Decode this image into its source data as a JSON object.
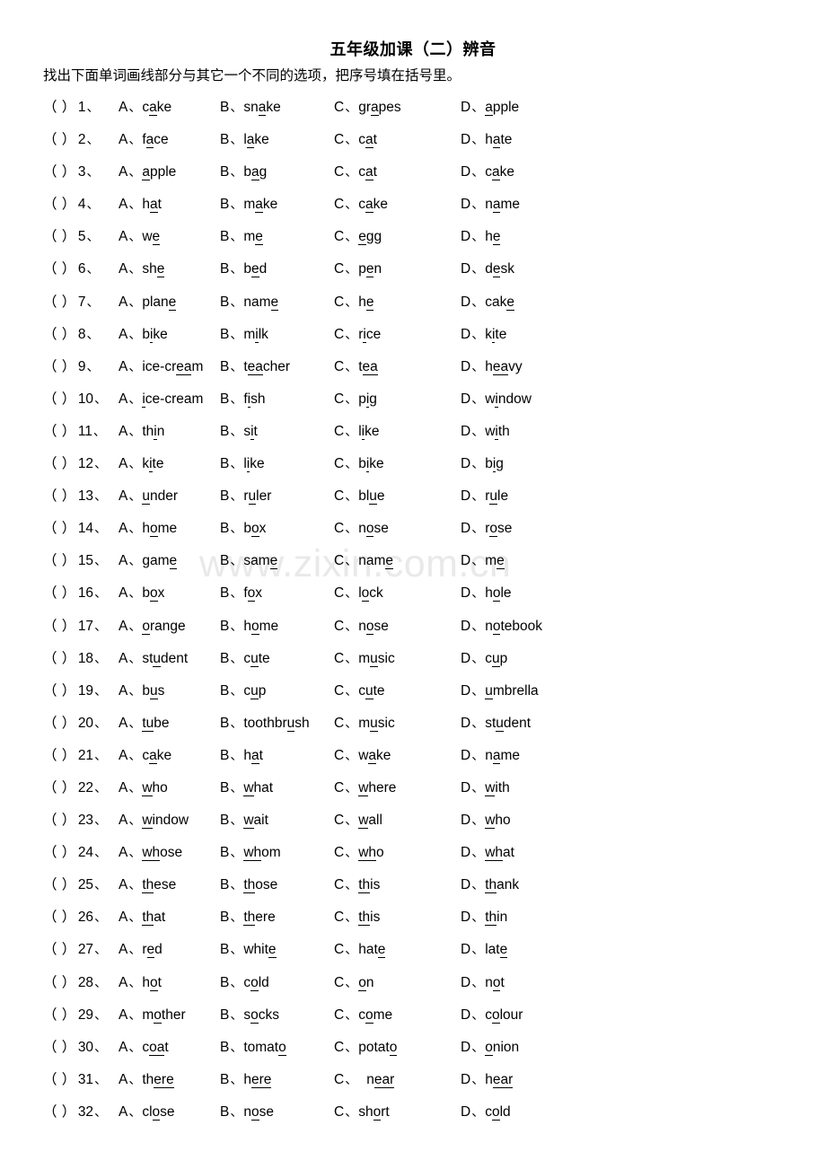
{
  "document": {
    "title": "五年级加课（二）辨音",
    "instruction": "找出下面单词画线部分与其它一个不同的选项，把序号填在括号里。",
    "watermark": "www.zixin.com.cn",
    "paren_blank": "（ ）",
    "cn_comma": "、",
    "option_letters": [
      "A",
      "B",
      "C",
      "D"
    ]
  },
  "questions": [
    {
      "number": "1",
      "options": [
        {
          "letter": "A",
          "pre": "c",
          "mark": "a",
          "post": "ke"
        },
        {
          "letter": "B",
          "pre": "sn",
          "mark": "a",
          "post": "ke"
        },
        {
          "letter": "C",
          "pre": "gr",
          "mark": "a",
          "post": "pes"
        },
        {
          "letter": "D",
          "pre": "",
          "mark": "a",
          "post": "pple"
        }
      ]
    },
    {
      "number": "2",
      "options": [
        {
          "letter": "A",
          "pre": "f",
          "mark": "a",
          "post": "ce"
        },
        {
          "letter": "B",
          "pre": "l",
          "mark": "a",
          "post": "ke"
        },
        {
          "letter": "C",
          "pre": "c",
          "mark": "a",
          "post": "t"
        },
        {
          "letter": "D",
          "pre": "h",
          "mark": "a",
          "post": "te"
        }
      ]
    },
    {
      "number": "3",
      "options": [
        {
          "letter": "A",
          "pre": "",
          "mark": "a",
          "post": "pple"
        },
        {
          "letter": "B",
          "pre": "b",
          "mark": "a",
          "post": "g"
        },
        {
          "letter": "C",
          "pre": "c",
          "mark": "a",
          "post": "t"
        },
        {
          "letter": "D",
          "pre": "c",
          "mark": "a",
          "post": "ke"
        }
      ]
    },
    {
      "number": "4",
      "options": [
        {
          "letter": "A",
          "pre": "h",
          "mark": "a",
          "post": "t"
        },
        {
          "letter": "B",
          "pre": "m",
          "mark": "a",
          "post": "ke"
        },
        {
          "letter": "C",
          "pre": "c",
          "mark": "a",
          "post": "ke"
        },
        {
          "letter": "D",
          "pre": "n",
          "mark": "a",
          "post": "me"
        }
      ]
    },
    {
      "number": "5",
      "options": [
        {
          "letter": "A",
          "pre": "w",
          "mark": "e",
          "post": ""
        },
        {
          "letter": "B",
          "pre": "m",
          "mark": "e",
          "post": ""
        },
        {
          "letter": "C",
          "pre": "",
          "mark": "e",
          "post": "gg"
        },
        {
          "letter": "D",
          "pre": "h",
          "mark": "e",
          "post": ""
        }
      ]
    },
    {
      "number": "6",
      "options": [
        {
          "letter": "A",
          "pre": "sh",
          "mark": "e",
          "post": ""
        },
        {
          "letter": "B",
          "pre": "b",
          "mark": "e",
          "post": "d"
        },
        {
          "letter": "C",
          "pre": "p",
          "mark": "e",
          "post": "n"
        },
        {
          "letter": "D",
          "pre": "d",
          "mark": "e",
          "post": "sk"
        }
      ]
    },
    {
      "number": "7",
      "options": [
        {
          "letter": "A",
          "pre": "plan",
          "mark": "e",
          "post": ""
        },
        {
          "letter": "B",
          "pre": "nam",
          "mark": "e",
          "post": ""
        },
        {
          "letter": "C",
          "pre": "h",
          "mark": "e",
          "post": ""
        },
        {
          "letter": "D",
          "pre": "cak",
          "mark": "e",
          "post": ""
        }
      ]
    },
    {
      "number": "8",
      "options": [
        {
          "letter": "A",
          "pre": "b",
          "mark": "i",
          "post": "ke"
        },
        {
          "letter": "B",
          "pre": "m",
          "mark": "i",
          "post": "lk"
        },
        {
          "letter": "C",
          "pre": "r",
          "mark": "i",
          "post": "ce"
        },
        {
          "letter": "D",
          "pre": "k",
          "mark": "i",
          "post": "te"
        }
      ]
    },
    {
      "number": "9",
      "options": [
        {
          "letter": "A",
          "pre": "ice-cr",
          "mark": "ea",
          "post": "m"
        },
        {
          "letter": "B",
          "pre": "t",
          "mark": "ea",
          "post": "cher"
        },
        {
          "letter": "C",
          "pre": "t",
          "mark": "ea",
          "post": ""
        },
        {
          "letter": "D",
          "pre": "h",
          "mark": "ea",
          "post": "vy"
        }
      ]
    },
    {
      "number": "10",
      "options": [
        {
          "letter": "A",
          "pre": "",
          "mark": "i",
          "post": "ce-cream"
        },
        {
          "letter": "B",
          "pre": "f",
          "mark": "i",
          "post": "sh"
        },
        {
          "letter": "C",
          "pre": "p",
          "mark": "i",
          "post": "g"
        },
        {
          "letter": "D",
          "pre": "w",
          "mark": "i",
          "post": "ndow"
        }
      ]
    },
    {
      "number": "11",
      "options": [
        {
          "letter": "A",
          "pre": "th",
          "mark": "i",
          "post": "n"
        },
        {
          "letter": "B",
          "pre": "s",
          "mark": "i",
          "post": "t"
        },
        {
          "letter": "C",
          "pre": "l",
          "mark": "i",
          "post": "ke"
        },
        {
          "letter": "D",
          "pre": "w",
          "mark": "i",
          "post": "th"
        }
      ]
    },
    {
      "number": "12",
      "options": [
        {
          "letter": "A",
          "pre": "k",
          "mark": "i",
          "post": "te"
        },
        {
          "letter": "B",
          "pre": "l",
          "mark": "i",
          "post": "ke"
        },
        {
          "letter": "C",
          "pre": "b",
          "mark": "i",
          "post": "ke"
        },
        {
          "letter": "D",
          "pre": "b",
          "mark": "i",
          "post": "g"
        }
      ]
    },
    {
      "number": "13",
      "options": [
        {
          "letter": "A",
          "pre": "",
          "mark": "u",
          "post": "nder"
        },
        {
          "letter": "B",
          "pre": "r",
          "mark": "u",
          "post": "ler"
        },
        {
          "letter": "C",
          "pre": "bl",
          "mark": "u",
          "post": "e"
        },
        {
          "letter": "D",
          "pre": "r",
          "mark": "u",
          "post": "le"
        }
      ]
    },
    {
      "number": "14",
      "options": [
        {
          "letter": "A",
          "pre": "h",
          "mark": "o",
          "post": "me"
        },
        {
          "letter": "B",
          "pre": "b",
          "mark": "o",
          "post": "x"
        },
        {
          "letter": "C",
          "pre": "n",
          "mark": "o",
          "post": "se"
        },
        {
          "letter": "D",
          "pre": "r",
          "mark": "o",
          "post": "se"
        }
      ]
    },
    {
      "number": "15",
      "options": [
        {
          "letter": "A",
          "pre": "gam",
          "mark": "e",
          "post": ""
        },
        {
          "letter": "B",
          "pre": "sam",
          "mark": "e",
          "post": ""
        },
        {
          "letter": "C",
          "pre": "nam",
          "mark": "e",
          "post": ""
        },
        {
          "letter": "D",
          "pre": "m",
          "mark": "e",
          "post": ""
        }
      ]
    },
    {
      "number": "16",
      "options": [
        {
          "letter": "A",
          "pre": "b",
          "mark": "o",
          "post": "x"
        },
        {
          "letter": "B",
          "pre": "f",
          "mark": "o",
          "post": "x"
        },
        {
          "letter": "C",
          "pre": "l",
          "mark": "o",
          "post": "ck"
        },
        {
          "letter": "D",
          "pre": "h",
          "mark": "o",
          "post": "le"
        }
      ]
    },
    {
      "number": "17",
      "options": [
        {
          "letter": "A",
          "pre": "",
          "mark": "o",
          "post": "range"
        },
        {
          "letter": "B",
          "pre": "h",
          "mark": "o",
          "post": "me"
        },
        {
          "letter": "C",
          "pre": "n",
          "mark": "o",
          "post": "se"
        },
        {
          "letter": "D",
          "pre": "n",
          "mark": "o",
          "post": "tebook"
        }
      ]
    },
    {
      "number": "18",
      "options": [
        {
          "letter": "A",
          "pre": "st",
          "mark": "u",
          "post": "dent"
        },
        {
          "letter": "B",
          "pre": "c",
          "mark": "u",
          "post": "te"
        },
        {
          "letter": "C",
          "pre": "m",
          "mark": "u",
          "post": "sic"
        },
        {
          "letter": "D",
          "pre": "c",
          "mark": "u",
          "post": "p"
        }
      ]
    },
    {
      "number": "19",
      "options": [
        {
          "letter": "A",
          "pre": "b",
          "mark": "u",
          "post": "s"
        },
        {
          "letter": "B",
          "pre": "c",
          "mark": "u",
          "post": "p"
        },
        {
          "letter": "C",
          "pre": "c",
          "mark": "u",
          "post": "te"
        },
        {
          "letter": "D",
          "pre": "",
          "mark": "u",
          "post": "mbrella"
        }
      ]
    },
    {
      "number": "20",
      "options": [
        {
          "letter": "A",
          "pre": "",
          "mark": "tu",
          "post": "be"
        },
        {
          "letter": "B",
          "pre": "toothbr",
          "mark": "u",
          "post": "sh"
        },
        {
          "letter": "C",
          "pre": "m",
          "mark": "u",
          "post": "sic"
        },
        {
          "letter": "D",
          "pre": "st",
          "mark": "u",
          "post": "dent"
        }
      ]
    },
    {
      "number": "21",
      "options": [
        {
          "letter": "A",
          "pre": "c",
          "mark": "a",
          "post": "ke"
        },
        {
          "letter": "B",
          "pre": "h",
          "mark": "a",
          "post": "t"
        },
        {
          "letter": "C",
          "pre": "w",
          "mark": "a",
          "post": "ke"
        },
        {
          "letter": "D",
          "pre": "n",
          "mark": "a",
          "post": "me"
        }
      ]
    },
    {
      "number": "22",
      "options": [
        {
          "letter": "A",
          "pre": "",
          "mark": "w",
          "post": "ho"
        },
        {
          "letter": "B",
          "pre": "",
          "mark": "w",
          "post": "hat"
        },
        {
          "letter": "C",
          "pre": "",
          "mark": "w",
          "post": "here"
        },
        {
          "letter": "D",
          "pre": "",
          "mark": "w",
          "post": "ith"
        }
      ]
    },
    {
      "number": "23",
      "options": [
        {
          "letter": "A",
          "pre": "",
          "mark": "w",
          "post": "indow"
        },
        {
          "letter": "B",
          "pre": "",
          "mark": "w",
          "post": "ait"
        },
        {
          "letter": "C",
          "pre": "",
          "mark": "w",
          "post": "all"
        },
        {
          "letter": "D",
          "pre": "",
          "mark": "w",
          "post": "ho"
        }
      ]
    },
    {
      "number": "24",
      "options": [
        {
          "letter": "A",
          "pre": "",
          "mark": "wh",
          "post": "ose"
        },
        {
          "letter": "B",
          "pre": "",
          "mark": "wh",
          "post": "om"
        },
        {
          "letter": "C",
          "pre": "",
          "mark": "wh",
          "post": "o"
        },
        {
          "letter": "D",
          "pre": "",
          "mark": "wh",
          "post": "at"
        }
      ]
    },
    {
      "number": "25",
      "options": [
        {
          "letter": "A",
          "pre": "",
          "mark": "th",
          "post": "ese"
        },
        {
          "letter": "B",
          "pre": "",
          "mark": "th",
          "post": "ose"
        },
        {
          "letter": "C",
          "pre": "",
          "mark": "th",
          "post": "is"
        },
        {
          "letter": "D",
          "pre": "",
          "mark": "th",
          "post": "ank"
        }
      ]
    },
    {
      "number": "26",
      "options": [
        {
          "letter": "A",
          "pre": "",
          "mark": "th",
          "post": "at"
        },
        {
          "letter": "B",
          "pre": "",
          "mark": "th",
          "post": "ere"
        },
        {
          "letter": "C",
          "pre": "",
          "mark": "th",
          "post": "is"
        },
        {
          "letter": "D",
          "pre": "",
          "mark": "th",
          "post": "in"
        }
      ]
    },
    {
      "number": "27",
      "options": [
        {
          "letter": "A",
          "pre": "r",
          "mark": "e",
          "post": "d"
        },
        {
          "letter": "B",
          "pre": "whit",
          "mark": "e",
          "post": ""
        },
        {
          "letter": "C",
          "pre": "hat",
          "mark": "e",
          "post": ""
        },
        {
          "letter": "D",
          "pre": "lat",
          "mark": "e",
          "post": ""
        }
      ]
    },
    {
      "number": "28",
      "options": [
        {
          "letter": "A",
          "pre": "h",
          "mark": "o",
          "post": "t"
        },
        {
          "letter": "B",
          "pre": "c",
          "mark": "o",
          "post": "ld"
        },
        {
          "letter": "C",
          "pre": "",
          "mark": "o",
          "post": "n"
        },
        {
          "letter": "D",
          "pre": "n",
          "mark": "o",
          "post": "t"
        }
      ]
    },
    {
      "number": "29",
      "options": [
        {
          "letter": "A",
          "pre": "m",
          "mark": "o",
          "post": "ther"
        },
        {
          "letter": "B",
          "pre": "s",
          "mark": "o",
          "post": "cks"
        },
        {
          "letter": "C",
          "pre": "c",
          "mark": "o",
          "post": "me"
        },
        {
          "letter": "D",
          "pre": "c",
          "mark": "o",
          "post": "lour"
        }
      ]
    },
    {
      "number": "30",
      "options": [
        {
          "letter": "A",
          "pre": "c",
          "mark": "oa",
          "post": "t"
        },
        {
          "letter": "B",
          "pre": "tomat",
          "mark": "o",
          "post": ""
        },
        {
          "letter": "C",
          "pre": "potat",
          "mark": "o",
          "post": ""
        },
        {
          "letter": "D",
          "pre": "",
          "mark": "o",
          "post": "nion"
        }
      ]
    },
    {
      "number": "31",
      "options": [
        {
          "letter": "A",
          "pre": "th",
          "mark": "ere",
          "post": ""
        },
        {
          "letter": "B",
          "pre": "h",
          "mark": "ere",
          "post": ""
        },
        {
          "letter": "C",
          "pre": "n",
          "mark": "ear",
          "post": "",
          "indent": true
        },
        {
          "letter": "D",
          "pre": "h",
          "mark": "ear",
          "post": ""
        }
      ]
    },
    {
      "number": "32",
      "options": [
        {
          "letter": "A",
          "pre": "cl",
          "mark": "o",
          "post": "se"
        },
        {
          "letter": "B",
          "pre": "n",
          "mark": "o",
          "post": "se"
        },
        {
          "letter": "C",
          "pre": "sh",
          "mark": "o",
          "post": "rt"
        },
        {
          "letter": "D",
          "pre": "c",
          "mark": "o",
          "post": "ld"
        }
      ]
    }
  ]
}
